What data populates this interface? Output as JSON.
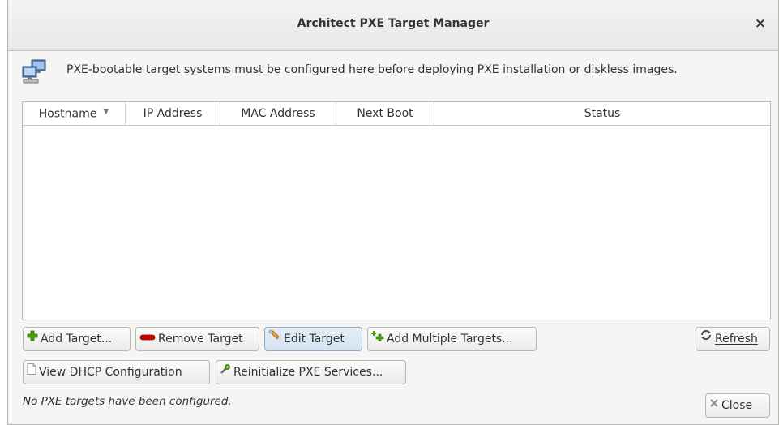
{
  "window": {
    "title": "Architect PXE Target Manager",
    "close_glyph": "×"
  },
  "info": {
    "icon": "network-computers-icon",
    "text": "PXE-bootable target systems must be configured here before deploying PXE installation or diskless images."
  },
  "table": {
    "columns": [
      "Hostname",
      "IP Address",
      "MAC Address",
      "Next Boot",
      "Status"
    ],
    "sort_indicator": "▼",
    "rows": []
  },
  "buttons": {
    "add_target": "Add Target...",
    "remove_target": "Remove Target",
    "edit_target": "Edit Target",
    "add_multiple_targets": "Add Multiple Targets...",
    "refresh": "Refresh",
    "view_dhcp": "View DHCP Configuration",
    "reinitialize_pxe": "Reinitialize PXE Services...",
    "close": "Close"
  },
  "status_message": "No PXE targets have been configured.",
  "colors": {
    "add_green": "#4e9a06",
    "remove_red": "#cc0000",
    "hover_blue": "#d5e3f2"
  }
}
